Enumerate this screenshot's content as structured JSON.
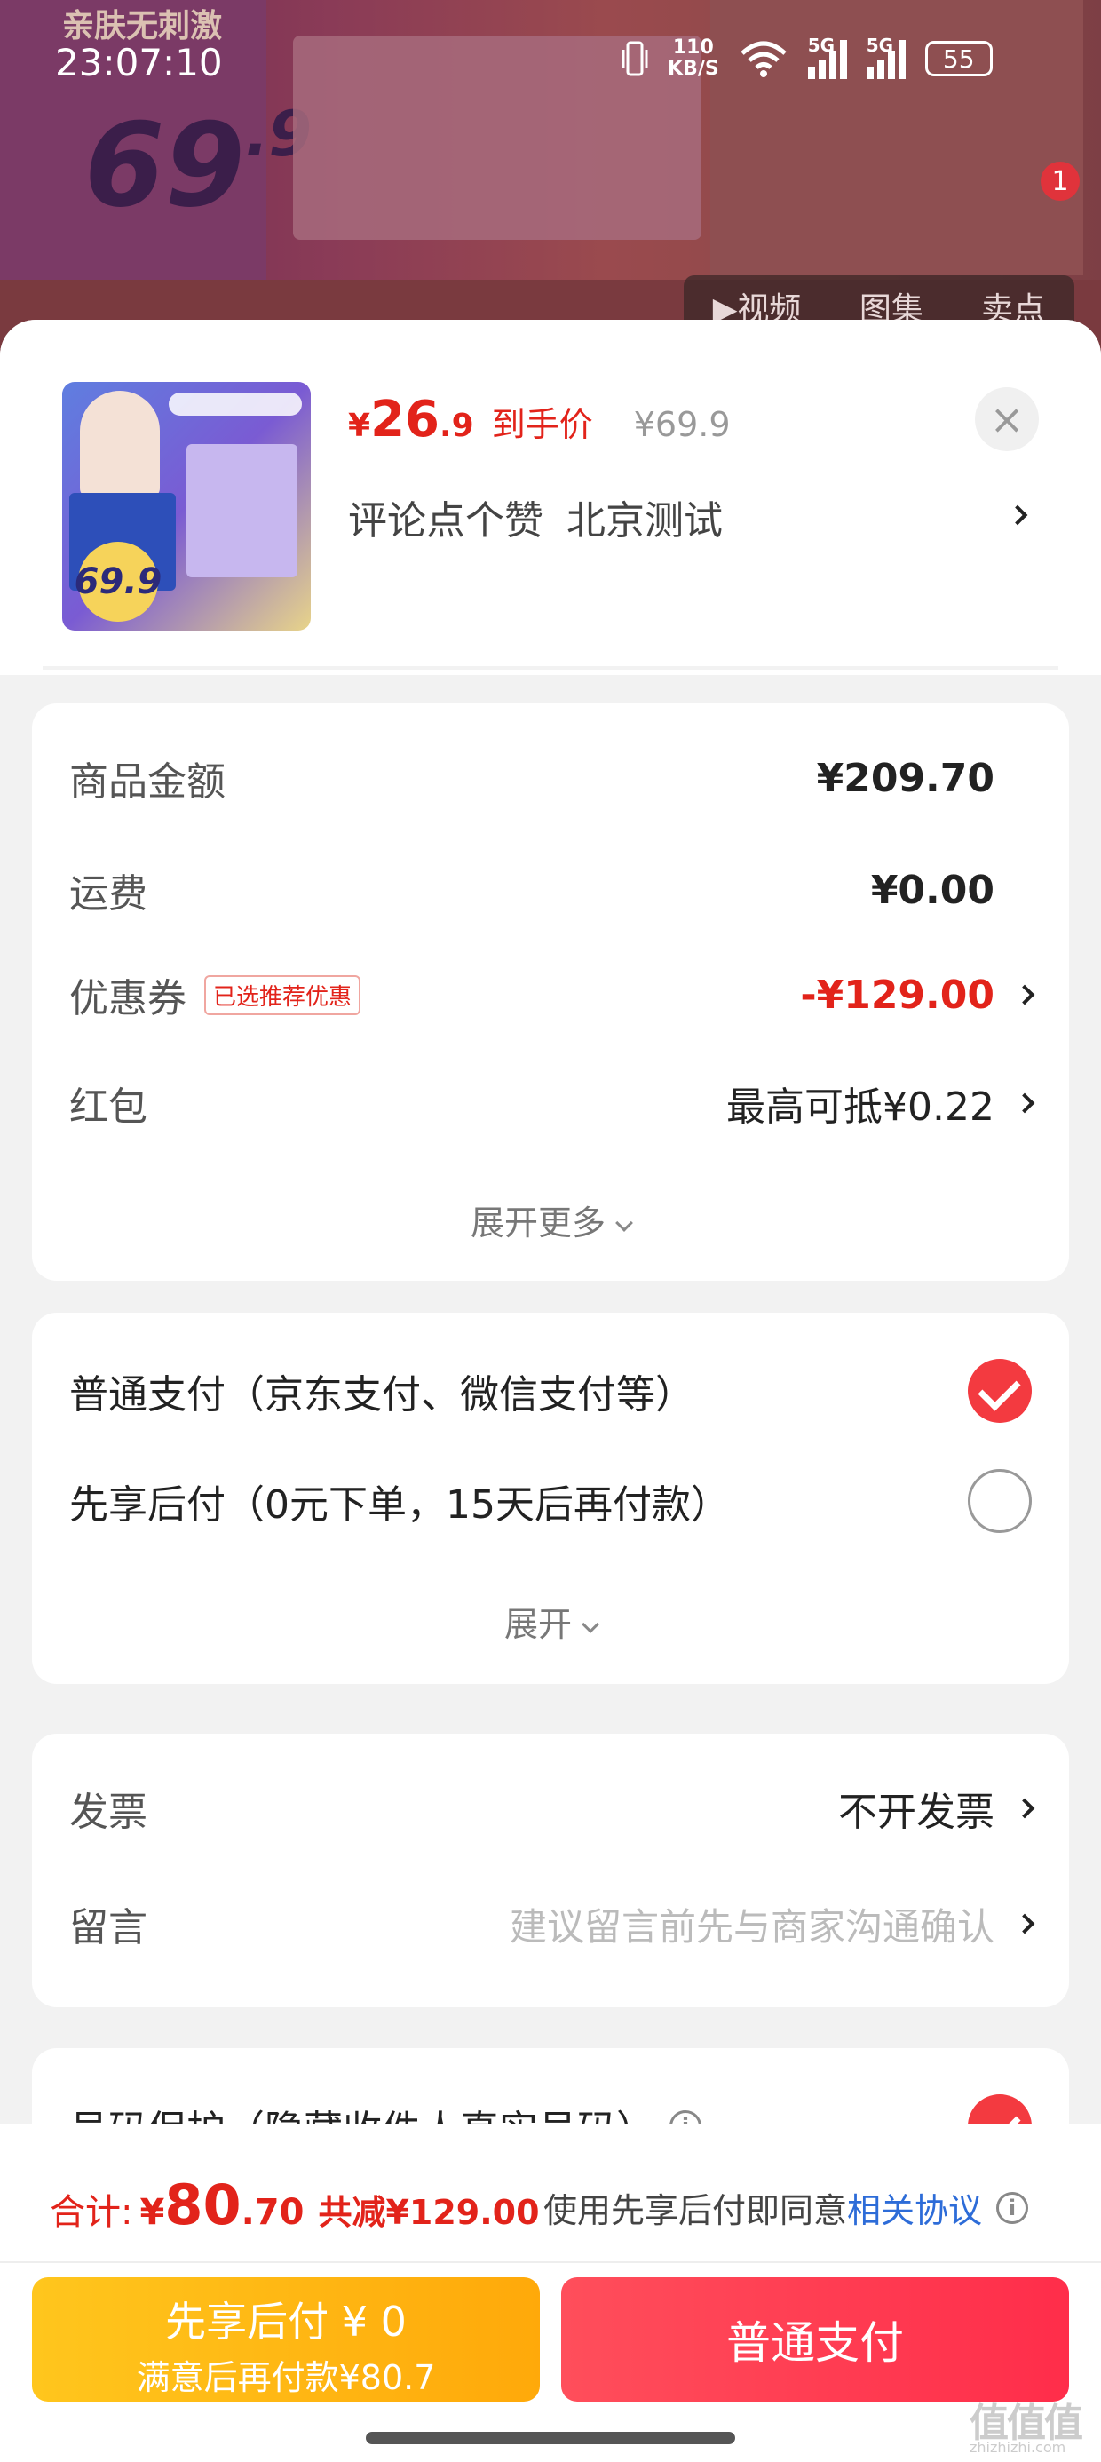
{
  "status_bar": {
    "time": "23:07:10",
    "net_speed_value": "110",
    "net_speed_unit": "KB/S",
    "sim1": "5G",
    "sim2": "5G",
    "battery": "55"
  },
  "backdrop": {
    "poster_tag": "亲肤无刺激",
    "poster_price_int": "69",
    "poster_price_dec": ".9",
    "tab_video": "▶视频",
    "tab_image": "图集",
    "tab_sale": "卖点",
    "badge_count": "1"
  },
  "product": {
    "thumb_price": "69.9",
    "price_currency": "¥",
    "price_int": "26",
    "price_dec": ".9",
    "price_tag": "到手价",
    "original_price": "¥69.9",
    "subtitle_part1": "评论点个赞",
    "subtitle_part2": "北京测试",
    "close_label": "×"
  },
  "fees": {
    "goods_amount_label": "商品金额",
    "goods_amount_value": "¥209.70",
    "shipping_label": "运费",
    "shipping_value": "¥0.00",
    "coupon_label": "优惠券",
    "coupon_pill": "已选推荐优惠",
    "coupon_value": "-¥129.00",
    "redpacket_label": "红包",
    "redpacket_value": "最高可抵¥0.22",
    "expand_more": "展开更多"
  },
  "payment": {
    "normal_label": "普通支付（京东支付、微信支付等）",
    "later_label": "先享后付（0元下单，15天后再付款）",
    "expand": "展开"
  },
  "extras": {
    "invoice_label": "发票",
    "invoice_value": "不开发票",
    "message_label": "留言",
    "message_placeholder": "建议留言前先与商家沟通确认",
    "privacy_label": "号码保护（隐藏收件人真实号码）"
  },
  "bottom": {
    "total_label": "合计:",
    "total_currency": "¥",
    "total_int": "80",
    "total_dec": ".70",
    "total_save": "共减¥129.00",
    "agree_text": "使用先享后付即同意",
    "agree_link": "相关协议",
    "btn_later_line1": "先享后付 ¥ 0",
    "btn_later_line2": "满意后再付款¥80.7",
    "btn_normal": "普通支付",
    "watermark": "值值值",
    "watermark_sub": "zhizhizhi.com"
  },
  "colors": {
    "accent_red": "#e2231a",
    "pay_later_yellow": "#ffb314",
    "pay_normal_red": "#ff3a50",
    "link_blue": "#2d6cd8"
  },
  "icons": [
    "vibrate-icon",
    "wifi-icon",
    "signal-icon",
    "battery-icon",
    "close-icon",
    "chevron-right-icon",
    "chevron-down-icon",
    "check-icon",
    "radio-icon",
    "info-icon"
  ]
}
